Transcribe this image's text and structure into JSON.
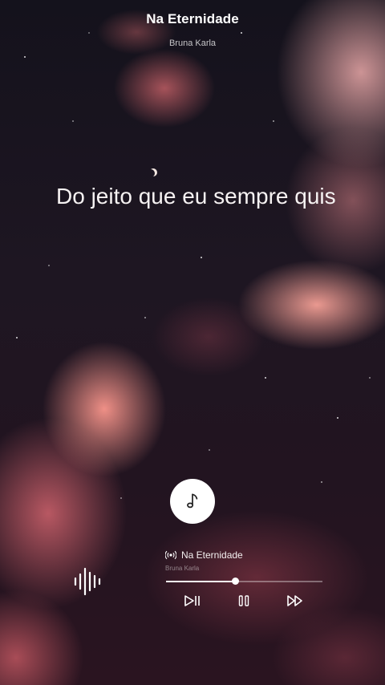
{
  "header": {
    "title": "Na Eternidade",
    "artist": "Bruna Karla"
  },
  "lyric": {
    "line": "Do jeito que eu sempre quis"
  },
  "player": {
    "note_icon": "music-note-icon",
    "wave_icon": "sound-wave-icon",
    "radio_icon": "radio-broadcast-icon",
    "title": "Na Eternidade",
    "artist": "Bruna Karla",
    "progress": 0.44,
    "controls": [
      "skip-to-start-icon",
      "pause-icon",
      "fast-forward-icon"
    ]
  },
  "colors": {
    "accent": "#ffffff",
    "cloud": "#e98f8a",
    "sky": "#1b1520"
  }
}
